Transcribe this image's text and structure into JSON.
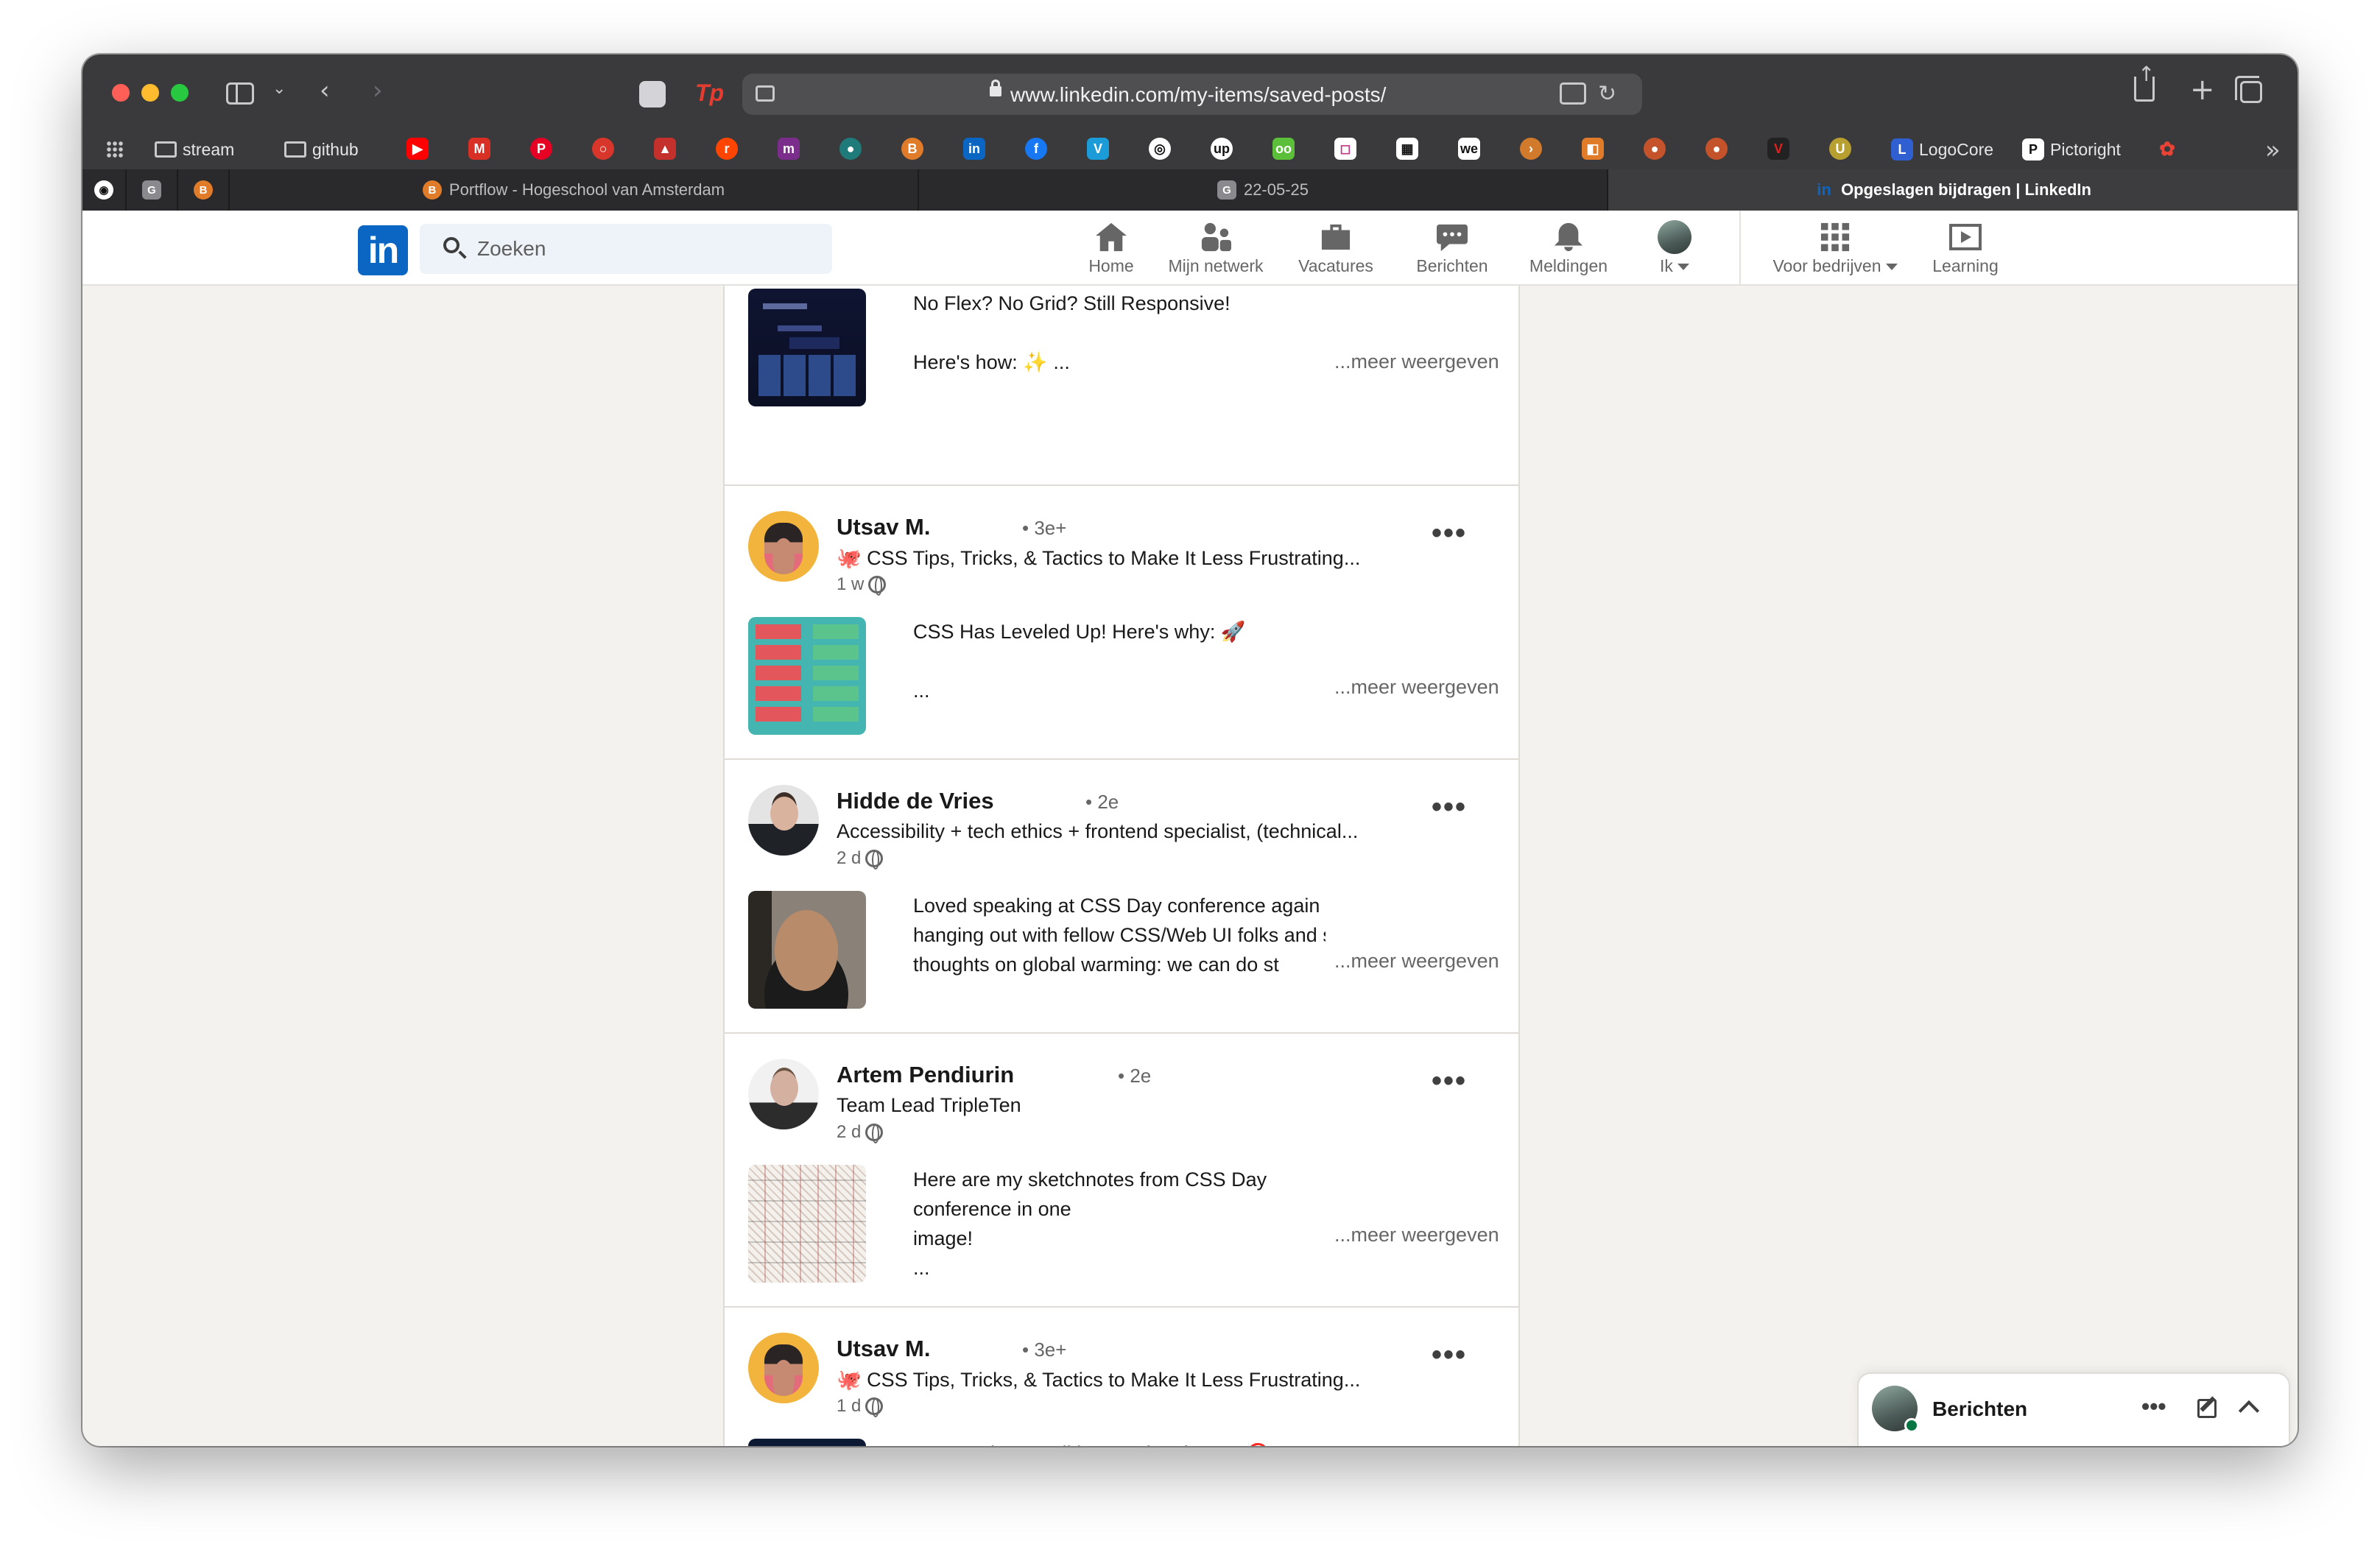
{
  "browser": {
    "url": "www.linkedin.com/my-items/saved-posts/",
    "bookmarks": [
      {
        "label": "stream"
      },
      {
        "label": "github"
      },
      {
        "label": "LogoCore"
      },
      {
        "label": "Pictoright"
      }
    ],
    "tabs": [
      {
        "label": "Portflow - Hogeschool van Amsterdam"
      },
      {
        "label": "22-05-25"
      },
      {
        "label": "Opgeslagen bijdragen | LinkedIn"
      }
    ]
  },
  "nav": {
    "search_placeholder": "Zoeken",
    "items": [
      {
        "label": "Home"
      },
      {
        "label": "Mijn netwerk"
      },
      {
        "label": "Vacatures"
      },
      {
        "label": "Berichten"
      },
      {
        "label": "Meldingen"
      },
      {
        "label": "Ik"
      },
      {
        "label": "Voor bedrijven"
      },
      {
        "label": "Learning"
      }
    ]
  },
  "posts": [
    {
      "body_lines": [
        "No Flex? No Grid? Still Responsive!",
        "",
        "Here's how: ✨ ..."
      ],
      "show_more": "...meer weergeven"
    },
    {
      "author": "Utsav M.",
      "degree": "• 3e+",
      "headline": "🐙 CSS Tips, Tricks, & Tactics to Make It Less Frustrating...",
      "time": "1 w",
      "body_lines": [
        "CSS Has Leveled Up! Here's why: 🚀",
        "",
        "..."
      ],
      "show_more": "...meer weergeven"
    },
    {
      "author": "Hidde de Vries",
      "degree": "• 2e",
      "headline": "Accessibility + tech ethics + frontend specialist, (technical...",
      "time": "2 d",
      "body_lines": [
        "Loved speaking at CSS Day conference again this year,",
        "hanging out with fellow CSS/Web UI folks and sharing my",
        "thoughts on global warming: we can do st"
      ],
      "show_more": "...meer weergeven"
    },
    {
      "author": "Artem Pendiurin",
      "degree": "• 2e",
      "headline": "Team Lead TripleTen",
      "time": "2 d",
      "body_lines": [
        "Here are my sketchnotes from CSS Day conference in one",
        "image!",
        "..."
      ],
      "show_more": "...meer weergeven"
    },
    {
      "author": "Utsav M.",
      "degree": "• 3e+",
      "headline": "🐙 CSS Tips, Tricks, & Tactics to Make It Less Frustrating...",
      "time": "1 d",
      "body_lines": [
        "How to change all input colors in CSS🎯"
      ]
    }
  ],
  "messaging": {
    "title": "Berichten"
  },
  "colors": {
    "linkedin_blue": "#0a66c2",
    "page_bg": "#f4f2ee",
    "online_green": "#057642"
  }
}
